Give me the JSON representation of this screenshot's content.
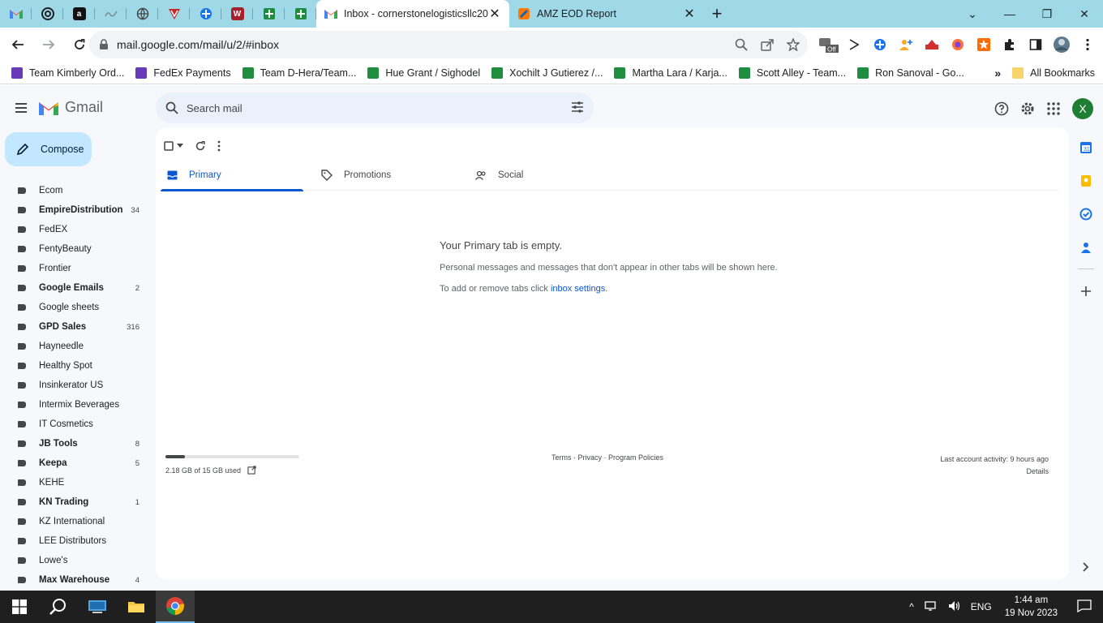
{
  "browser": {
    "tabs": [
      {
        "title": "Inbox - cornerstonelogisticsllc20",
        "active": true
      },
      {
        "title": "AMZ EOD Report",
        "active": false
      }
    ],
    "url": "mail.google.com/mail/u/2/#inbox",
    "bookmarks": [
      "Team Kimberly Ord...",
      "FedEx Payments",
      "Team D-Hera/Team...",
      "Hue Grant / Sighodel",
      "Xochilt J Gutierez /...",
      "Martha Lara / Karja...",
      "Scott Alley - Team...",
      "Ron Sanoval - Go..."
    ],
    "all_bookmarks": "All Bookmarks",
    "ext_off_badge": "Off"
  },
  "gmail": {
    "brand": "Gmail",
    "search_placeholder": "Search mail",
    "avatar_letter": "X",
    "compose_label": "Compose",
    "labels": [
      {
        "name": "Ecom",
        "count": "",
        "bold": false
      },
      {
        "name": "EmpireDistribution",
        "count": "34",
        "bold": true
      },
      {
        "name": "FedEX",
        "count": "",
        "bold": false
      },
      {
        "name": "FentyBeauty",
        "count": "",
        "bold": false
      },
      {
        "name": "Frontier",
        "count": "",
        "bold": false
      },
      {
        "name": "Google Emails",
        "count": "2",
        "bold": true
      },
      {
        "name": "Google sheets",
        "count": "",
        "bold": false
      },
      {
        "name": "GPD Sales",
        "count": "316",
        "bold": true
      },
      {
        "name": "Hayneedle",
        "count": "",
        "bold": false
      },
      {
        "name": "Healthy Spot",
        "count": "",
        "bold": false
      },
      {
        "name": "Insinkerator US",
        "count": "",
        "bold": false
      },
      {
        "name": "Intermix Beverages",
        "count": "",
        "bold": false
      },
      {
        "name": "IT Cosmetics",
        "count": "",
        "bold": false
      },
      {
        "name": "JB Tools",
        "count": "8",
        "bold": true
      },
      {
        "name": "Keepa",
        "count": "5",
        "bold": true
      },
      {
        "name": "KEHE",
        "count": "",
        "bold": false
      },
      {
        "name": "KN Trading",
        "count": "1",
        "bold": true
      },
      {
        "name": "KZ International",
        "count": "",
        "bold": false
      },
      {
        "name": "LEE Distributors",
        "count": "",
        "bold": false
      },
      {
        "name": "Lowe's",
        "count": "",
        "bold": false
      },
      {
        "name": "Max Warehouse",
        "count": "4",
        "bold": true
      }
    ],
    "category_tabs": [
      {
        "label": "Primary",
        "active": true
      },
      {
        "label": "Promotions",
        "active": false
      },
      {
        "label": "Social",
        "active": false
      }
    ],
    "empty_title": "Your Primary tab is empty.",
    "empty_desc": "Personal messages and messages that don't appear in other tabs will be shown here.",
    "empty_hint_prefix": "To add or remove tabs click ",
    "empty_hint_link": "inbox settings",
    "empty_hint_suffix": ".",
    "storage_text": "2.18 GB of 15 GB used",
    "storage_fraction": 0.145,
    "terms": "Terms · Privacy · Program Policies",
    "last_activity": "Last account activity: 9 hours ago",
    "details": "Details"
  },
  "taskbar": {
    "language": "ENG",
    "time": "1:44 am",
    "date": "19 Nov 2023"
  },
  "colors": {
    "tabstrip": "#9fd8e6",
    "accent": "#0b57d0",
    "compose": "#c2e7ff"
  }
}
